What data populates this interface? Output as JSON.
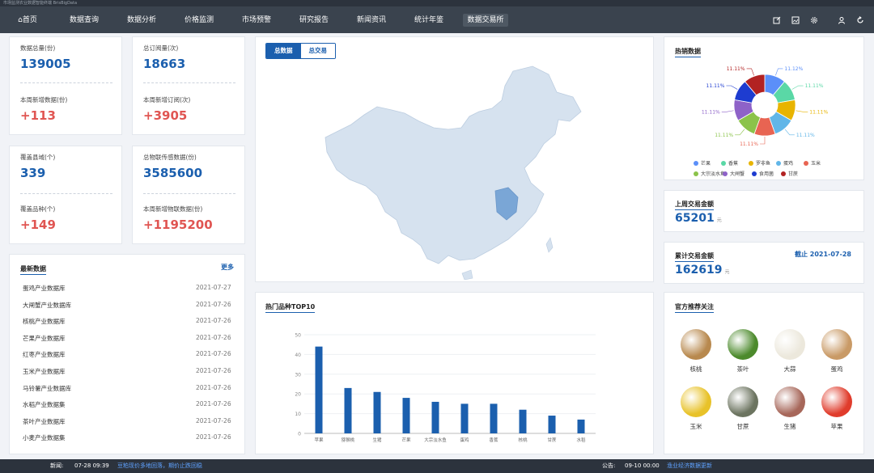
{
  "app": {
    "title": "市场监测农业数据智能终端 BrisBigData"
  },
  "nav": {
    "home": "首页",
    "items": [
      "数据查询",
      "数据分析",
      "价格监测",
      "市场预警",
      "研究报告",
      "新闻资讯",
      "统计年鉴",
      "数据交易所"
    ],
    "active": "数据交易所"
  },
  "stats": {
    "total_data": {
      "label": "数据总量(份)",
      "value": "139005"
    },
    "week_new_data": {
      "label": "本周新增数据(份)",
      "value": "+113"
    },
    "total_subs": {
      "label": "总订阅量(次)",
      "value": "18663"
    },
    "week_new_subs": {
      "label": "本周新增订阅(次)",
      "value": "+3905"
    },
    "counties": {
      "label": "覆盖县域(个)",
      "value": "339"
    },
    "iot_total": {
      "label": "总物联传感数据(份)",
      "value": "3585600"
    },
    "varieties": {
      "label": "覆盖品种(个)",
      "value": "+149"
    },
    "week_new_iot": {
      "label": "本周新增物联数据(份)",
      "value": "+1195200"
    }
  },
  "latest": {
    "title": "最新数据",
    "more": "更多",
    "items": [
      {
        "name": "蛋鸡产业数据库",
        "date": "2021-07-27"
      },
      {
        "name": "大闸蟹产业数据库",
        "date": "2021-07-26"
      },
      {
        "name": "核桃产业数据库",
        "date": "2021-07-26"
      },
      {
        "name": "芒果产业数据库",
        "date": "2021-07-26"
      },
      {
        "name": "红枣产业数据库",
        "date": "2021-07-26"
      },
      {
        "name": "玉米产业数据库",
        "date": "2021-07-26"
      },
      {
        "name": "马铃薯产业数据库",
        "date": "2021-07-26"
      },
      {
        "name": "水稻产业数据集",
        "date": "2021-07-26"
      },
      {
        "name": "茶叶产业数据库",
        "date": "2021-07-26"
      },
      {
        "name": "小麦产业数据集",
        "date": "2021-07-26"
      }
    ]
  },
  "map": {
    "tabs": [
      "总数据",
      "总交易"
    ],
    "active": "总数据"
  },
  "top10": {
    "title": "热门品种TOP10"
  },
  "hot": {
    "title": "热销数据"
  },
  "last_week": {
    "label": "上周交易金额",
    "value": "65201",
    "unit": "元"
  },
  "cumulative": {
    "label": "累计交易金额",
    "value": "162619",
    "unit": "元",
    "asof": "截止 2021-07-28"
  },
  "recommend": {
    "title": "官方推荐关注",
    "items": [
      {
        "name": "核桃",
        "color": "#b8894e"
      },
      {
        "name": "茶叶",
        "color": "#4c8a2c"
      },
      {
        "name": "大蒜",
        "color": "#ece8dc"
      },
      {
        "name": "蛋鸡",
        "color": "#c99a66"
      },
      {
        "name": "玉米",
        "color": "#e8c229"
      },
      {
        "name": "甘蔗",
        "color": "#6c7460"
      },
      {
        "name": "生猪",
        "color": "#a7675a"
      },
      {
        "name": "苹果",
        "color": "#e03c2c"
      }
    ]
  },
  "footer": {
    "news_label": "新闻:",
    "news_time": "07-28 09:39",
    "news_text": "豆粕现价多地回落，期价止跌回稳",
    "notice_label": "公告:",
    "notice_time": "09-10 00:00",
    "notice_text": "渔业经济数据更新"
  },
  "chart_data": [
    {
      "type": "bar",
      "title": "热门品种TOP10",
      "categories": [
        "苹果",
        "猕猴桃",
        "生猪",
        "芒果",
        "大宗淡水鱼",
        "蛋鸡",
        "香蕉",
        "核桃",
        "甘蔗",
        "水稻"
      ],
      "values": [
        44,
        23,
        21,
        18,
        16,
        15,
        15,
        12,
        9,
        7
      ],
      "ylim": [
        0,
        50
      ],
      "yticks": [
        0,
        10,
        20,
        30,
        40,
        50
      ],
      "color": "#1b5fae"
    },
    {
      "type": "pie",
      "title": "热销数据",
      "labels": [
        "芒果",
        "香蕉",
        "罗非鱼",
        "蛋鸡",
        "玉米",
        "大宗淡水鱼",
        "大闸蟹",
        "食用菌",
        "甘蔗"
      ],
      "values": [
        11.12,
        11.11,
        11.11,
        11.11,
        11.11,
        11.11,
        11.11,
        11.11,
        11.11
      ],
      "display": [
        "11.12%",
        "11.11%",
        "11.11%",
        "11.11%",
        "11.11%",
        "11.11%",
        "11.11%",
        "11.11%",
        "11.11%"
      ],
      "colors": [
        "#5b8ff9",
        "#5ad8a6",
        "#e8b400",
        "#61b6e8",
        "#e86452",
        "#8bc34a",
        "#8e62c8",
        "#1e3cd0",
        "#b22222"
      ]
    }
  ]
}
